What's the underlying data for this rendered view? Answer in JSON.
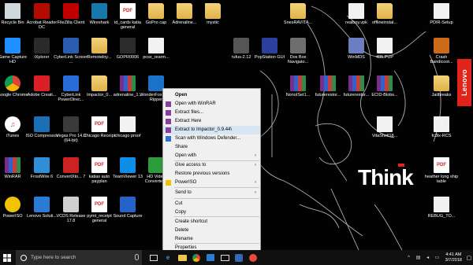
{
  "desktop": {
    "icons": [
      {
        "label": "Recycle Bin",
        "icon": "recycle-bin-icon"
      },
      {
        "label": "Acrobat Reader DC",
        "icon": "acrobat-icon"
      },
      {
        "label": "FileZilla Client",
        "icon": "filezilla-icon"
      },
      {
        "label": "Wireshark",
        "icon": "wireshark-icon"
      },
      {
        "label": "id_cards katia general",
        "icon": "pdf-file-icon"
      },
      {
        "label": "GoPro cap",
        "icon": "folder-icon"
      },
      {
        "label": "Adrenaline...",
        "icon": "folder-icon"
      },
      {
        "label": "mystic",
        "icon": "folder-icon"
      },
      {
        "label": "SnesRAVITA...",
        "icon": "folder-icon"
      },
      {
        "label": "realboy.vpk",
        "icon": "file-icon"
      },
      {
        "label": "offlineinstal...",
        "icon": "folder-icon"
      },
      {
        "label": "PDIR-Setup",
        "icon": "file-icon"
      },
      {
        "label": "Game Capture HD",
        "icon": "game-capture-icon"
      },
      {
        "label": "iXplorer",
        "icon": "ixplorer-icon"
      },
      {
        "label": "CyberLink Screen ...",
        "icon": "cyberlink-icon"
      },
      {
        "label": "Remoteloy...",
        "icon": "folder-icon"
      },
      {
        "label": "GOPR0006",
        "icon": "video-file-icon"
      },
      {
        "label": "pcsx_rearm...",
        "icon": "file-icon"
      },
      {
        "label": "rufus-2.12",
        "icon": "usb-icon"
      },
      {
        "label": "PopStation GUI",
        "icon": "popstation-icon"
      },
      {
        "label": "Dos Box Navigato...",
        "icon": "dosbox-icon"
      },
      {
        "label": "WinMDS",
        "icon": "winmds-icon"
      },
      {
        "label": "405.PUP",
        "icon": "file-icon"
      },
      {
        "label": "Crash Bandicoot...",
        "icon": "game-icon"
      },
      {
        "label": "Google Chrome",
        "icon": "chrome-icon"
      },
      {
        "label": "Adobe Creati...",
        "icon": "adobe-cc-icon"
      },
      {
        "label": "CyberLink PowerDirec...",
        "icon": "powerdirector-icon"
      },
      {
        "label": "Impactor_0...",
        "icon": "folder-icon"
      },
      {
        "label": "adrenaline_1...",
        "icon": "winrar-archive-icon"
      },
      {
        "label": "WonderFox DVD Ripper",
        "icon": "wonderfox-icon"
      },
      {
        "label": "NonoISet1...",
        "icon": "winrar-archive-icon"
      },
      {
        "label": "futurerestor...",
        "icon": "winrar-archive-icon"
      },
      {
        "label": "futurerestor...",
        "icon": "winrar-archive-icon"
      },
      {
        "label": "ECID-Blobs...",
        "icon": "winrar-archive-icon"
      },
      {
        "label": "Jailbreaks",
        "icon": "folder-icon"
      },
      {
        "label": "iTunes",
        "icon": "itunes-icon"
      },
      {
        "label": "ISO Compressor",
        "icon": "iso-icon"
      },
      {
        "label": "Vegas Pro 14.0 (64-bit)",
        "icon": "vegas-icon"
      },
      {
        "label": "Chicago Receipt",
        "icon": "pdf-file-icon"
      },
      {
        "label": "chicago proof",
        "icon": "file-icon"
      },
      {
        "label": "VitaShell18...",
        "icon": "file-icon"
      },
      {
        "label": "fc3lx-RCS",
        "icon": "audio-file-icon"
      },
      {
        "label": "WinRAR",
        "icon": "winrar-icon"
      },
      {
        "label": "FrostWire 6",
        "icon": "frostwire-icon"
      },
      {
        "label": "ConvertXto... 7",
        "icon": "convertx-icon"
      },
      {
        "label": "katias auto payplan",
        "icon": "pdf-file-icon"
      },
      {
        "label": "TeamViewer 13",
        "icon": "teamviewer-icon"
      },
      {
        "label": "HD Video Converter...",
        "icon": "hd-converter-icon"
      },
      {
        "label": "heather long ship table",
        "icon": "pdf-file-icon"
      },
      {
        "label": "PowerISO",
        "icon": "poweriso-icon"
      },
      {
        "label": "Lenovo Soluti...",
        "icon": "lenovo-solutions-icon"
      },
      {
        "label": "VCDS Release 17.8",
        "icon": "vcds-icon"
      },
      {
        "label": "pymt_receipt general",
        "icon": "pdf-file-icon"
      },
      {
        "label": "Sound Capture",
        "icon": "sound-capture-icon"
      },
      {
        "label": "REBUG_TO...",
        "icon": "file-icon"
      }
    ]
  },
  "context_menu": {
    "items": [
      {
        "label": "Open",
        "bold": true
      },
      {
        "label": "Open with WinRAR"
      },
      {
        "label": "Extract files..."
      },
      {
        "label": "Extract Here"
      },
      {
        "label": "Extract to Impactor_0.9.44\\",
        "highlighted": true
      },
      {
        "label": "Scan with Windows Defender..."
      },
      {
        "label": "Share"
      },
      {
        "label": "Open with",
        "submenu": true
      },
      {
        "label": "Give access to",
        "submenu": true
      },
      {
        "label": "Restore previous versions"
      },
      {
        "label": "PowerISO",
        "submenu": true
      },
      {
        "label": "Send to",
        "submenu": true
      },
      {
        "label": "Cut"
      },
      {
        "label": "Copy"
      },
      {
        "label": "Create shortcut"
      },
      {
        "label": "Delete"
      },
      {
        "label": "Rename"
      },
      {
        "label": "Properties"
      }
    ]
  },
  "branding": {
    "lenovo": "Lenovo",
    "think": "Think"
  },
  "taskbar": {
    "search_placeholder": "Type here to search",
    "time": "4:41 AM",
    "date": "3/7/2018"
  },
  "colors": {
    "menu_highlight": "#d8e6f3",
    "lenovo_red": "#e2231a",
    "taskbar": "#101010"
  }
}
